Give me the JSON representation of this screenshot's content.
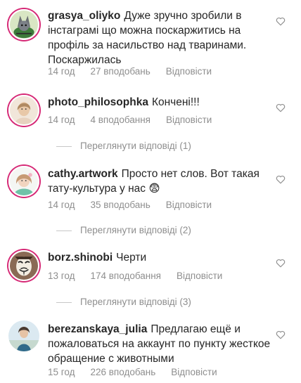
{
  "comments": [
    {
      "username": "grasya_oliyko",
      "text": "Дуже зручно зробили в інстаграмі що можна поскаржитись на профіль за насильство над тваринами. Поскаржилась",
      "time": "14 год",
      "likes": "27 вподобань",
      "reply": "Відповісти",
      "avatar_icon": "cartoon-cat-avatar"
    },
    {
      "username": "photo_philosophka",
      "text": "Кончені!!!",
      "time": "14 год",
      "likes": "4 вподобання",
      "reply": "Відповісти",
      "view_replies": "Переглянути відповіді (1)",
      "avatar_icon": "woman-portrait-avatar"
    },
    {
      "username": "cathy.artwork",
      "text": "Просто нет слов. Вот такая тату-культура у нас 😨",
      "time": "14 год",
      "likes": "35 вподобань",
      "reply": "Відповісти",
      "view_replies": "Переглянути відповіді (2)",
      "avatar_icon": "illustrated-girl-avatar"
    },
    {
      "username": "borz.shinobi",
      "text": "Черти",
      "time": "13 год",
      "likes": "174 вподобання",
      "reply": "Відповісти",
      "view_replies": "Переглянути відповіді (3)",
      "avatar_icon": "guy-fawkes-mask-avatar"
    },
    {
      "username": "berezanskaya_julia",
      "text": "Предлагаю ещё и пожаловаться на аккаунт по пункту жесткое обращение с животными",
      "time": "15 год",
      "likes": "226 вподобань",
      "reply": "Відповісти",
      "avatar_icon": "woman-outdoor-avatar"
    }
  ],
  "colors": {
    "text": "#262626",
    "secondary": "#8e8e8e",
    "story_ring": "#d62976",
    "divider": "#c7c7c7"
  },
  "icons": {
    "like": "heart-outline-icon"
  }
}
